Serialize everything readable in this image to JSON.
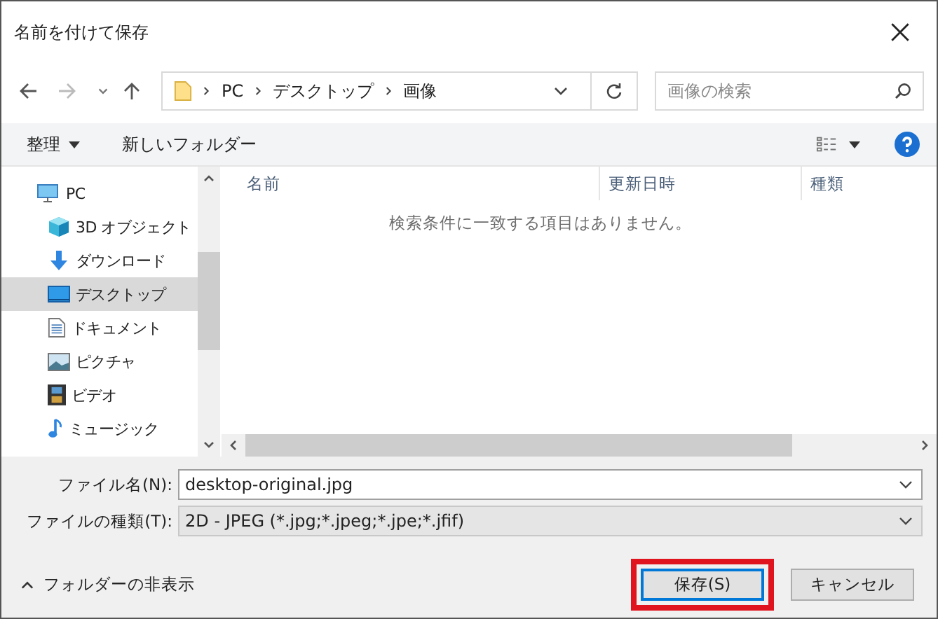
{
  "window": {
    "title": "名前を付けて保存"
  },
  "address_bar": {
    "crumbs": [
      "PC",
      "デスクトップ",
      "画像"
    ]
  },
  "search": {
    "placeholder": "画像の検索"
  },
  "toolbar": {
    "organize": "整理",
    "new_folder": "新しいフォルダー"
  },
  "sidebar": {
    "items": [
      {
        "label": "PC",
        "kind": "pc",
        "selected": false
      },
      {
        "label": "3D オブジェクト",
        "kind": "cube",
        "selected": false
      },
      {
        "label": "ダウンロード",
        "kind": "download",
        "selected": false
      },
      {
        "label": "デスクトップ",
        "kind": "desktop",
        "selected": true
      },
      {
        "label": "ドキュメント",
        "kind": "document",
        "selected": false
      },
      {
        "label": "ピクチャ",
        "kind": "picture",
        "selected": false
      },
      {
        "label": "ビデオ",
        "kind": "video",
        "selected": false
      },
      {
        "label": "ミュージック",
        "kind": "music",
        "selected": false
      }
    ]
  },
  "file_list": {
    "columns": [
      "名前",
      "更新日時",
      "種類"
    ],
    "empty_message": "検索条件に一致する項目はありません。"
  },
  "file_name": {
    "label": "ファイル名(N):",
    "value": "desktop-original.jpg"
  },
  "file_type": {
    "label": "ファイルの種類(T):",
    "value": "2D - JPEG (*.jpg;*.jpeg;*.jpe;*.jfif)"
  },
  "hide_folders": "フォルダーの非表示",
  "buttons": [
    {
      "label": "保存(S)",
      "kind": "primary",
      "highlighted": true
    },
    {
      "label": "キャンセル",
      "kind": "normal",
      "highlighted": false
    }
  ]
}
